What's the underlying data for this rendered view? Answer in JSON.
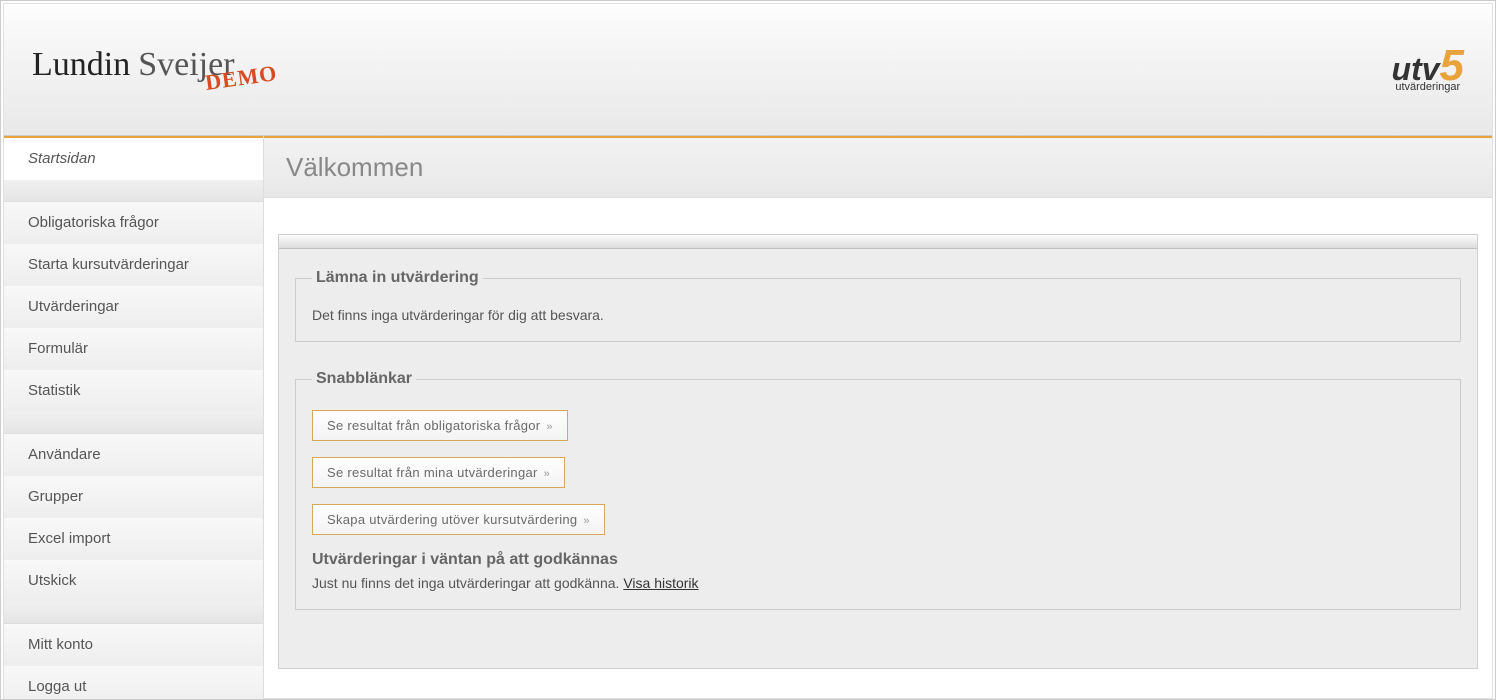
{
  "header": {
    "logo_left_1": "Lundin",
    "logo_left_2": "Sveijer",
    "logo_demo": "DEMO",
    "logo_right_main": "utv",
    "logo_right_num": "5",
    "logo_right_sub": "utvärderingar"
  },
  "sidebar": {
    "groups": [
      {
        "items": [
          {
            "label": "Startsidan",
            "active": true
          }
        ]
      },
      {
        "items": [
          {
            "label": "Obligatoriska frågor"
          },
          {
            "label": "Starta kursutvärderingar"
          },
          {
            "label": "Utvärderingar"
          },
          {
            "label": "Formulär"
          },
          {
            "label": "Statistik"
          }
        ]
      },
      {
        "items": [
          {
            "label": "Användare"
          },
          {
            "label": "Grupper"
          },
          {
            "label": "Excel import"
          },
          {
            "label": "Utskick"
          }
        ]
      },
      {
        "items": [
          {
            "label": "Mitt konto"
          },
          {
            "label": "Logga ut"
          }
        ]
      }
    ]
  },
  "main": {
    "title": "Välkommen",
    "submit_panel": {
      "legend": "Lämna in utvärdering",
      "text": "Det finns inga utvärderingar för dig att besvara."
    },
    "quicklinks_panel": {
      "legend": "Snabblänkar",
      "buttons": [
        "Se resultat från obligatoriska frågor",
        "Se resultat från mina utvärderingar",
        "Skapa utvärdering utöver kursutvärdering"
      ],
      "pending_heading": "Utvärderingar i väntan på att godkännas",
      "pending_text": "Just nu finns det inga utvärderingar att godkänna. ",
      "pending_link": "Visa historik"
    }
  }
}
